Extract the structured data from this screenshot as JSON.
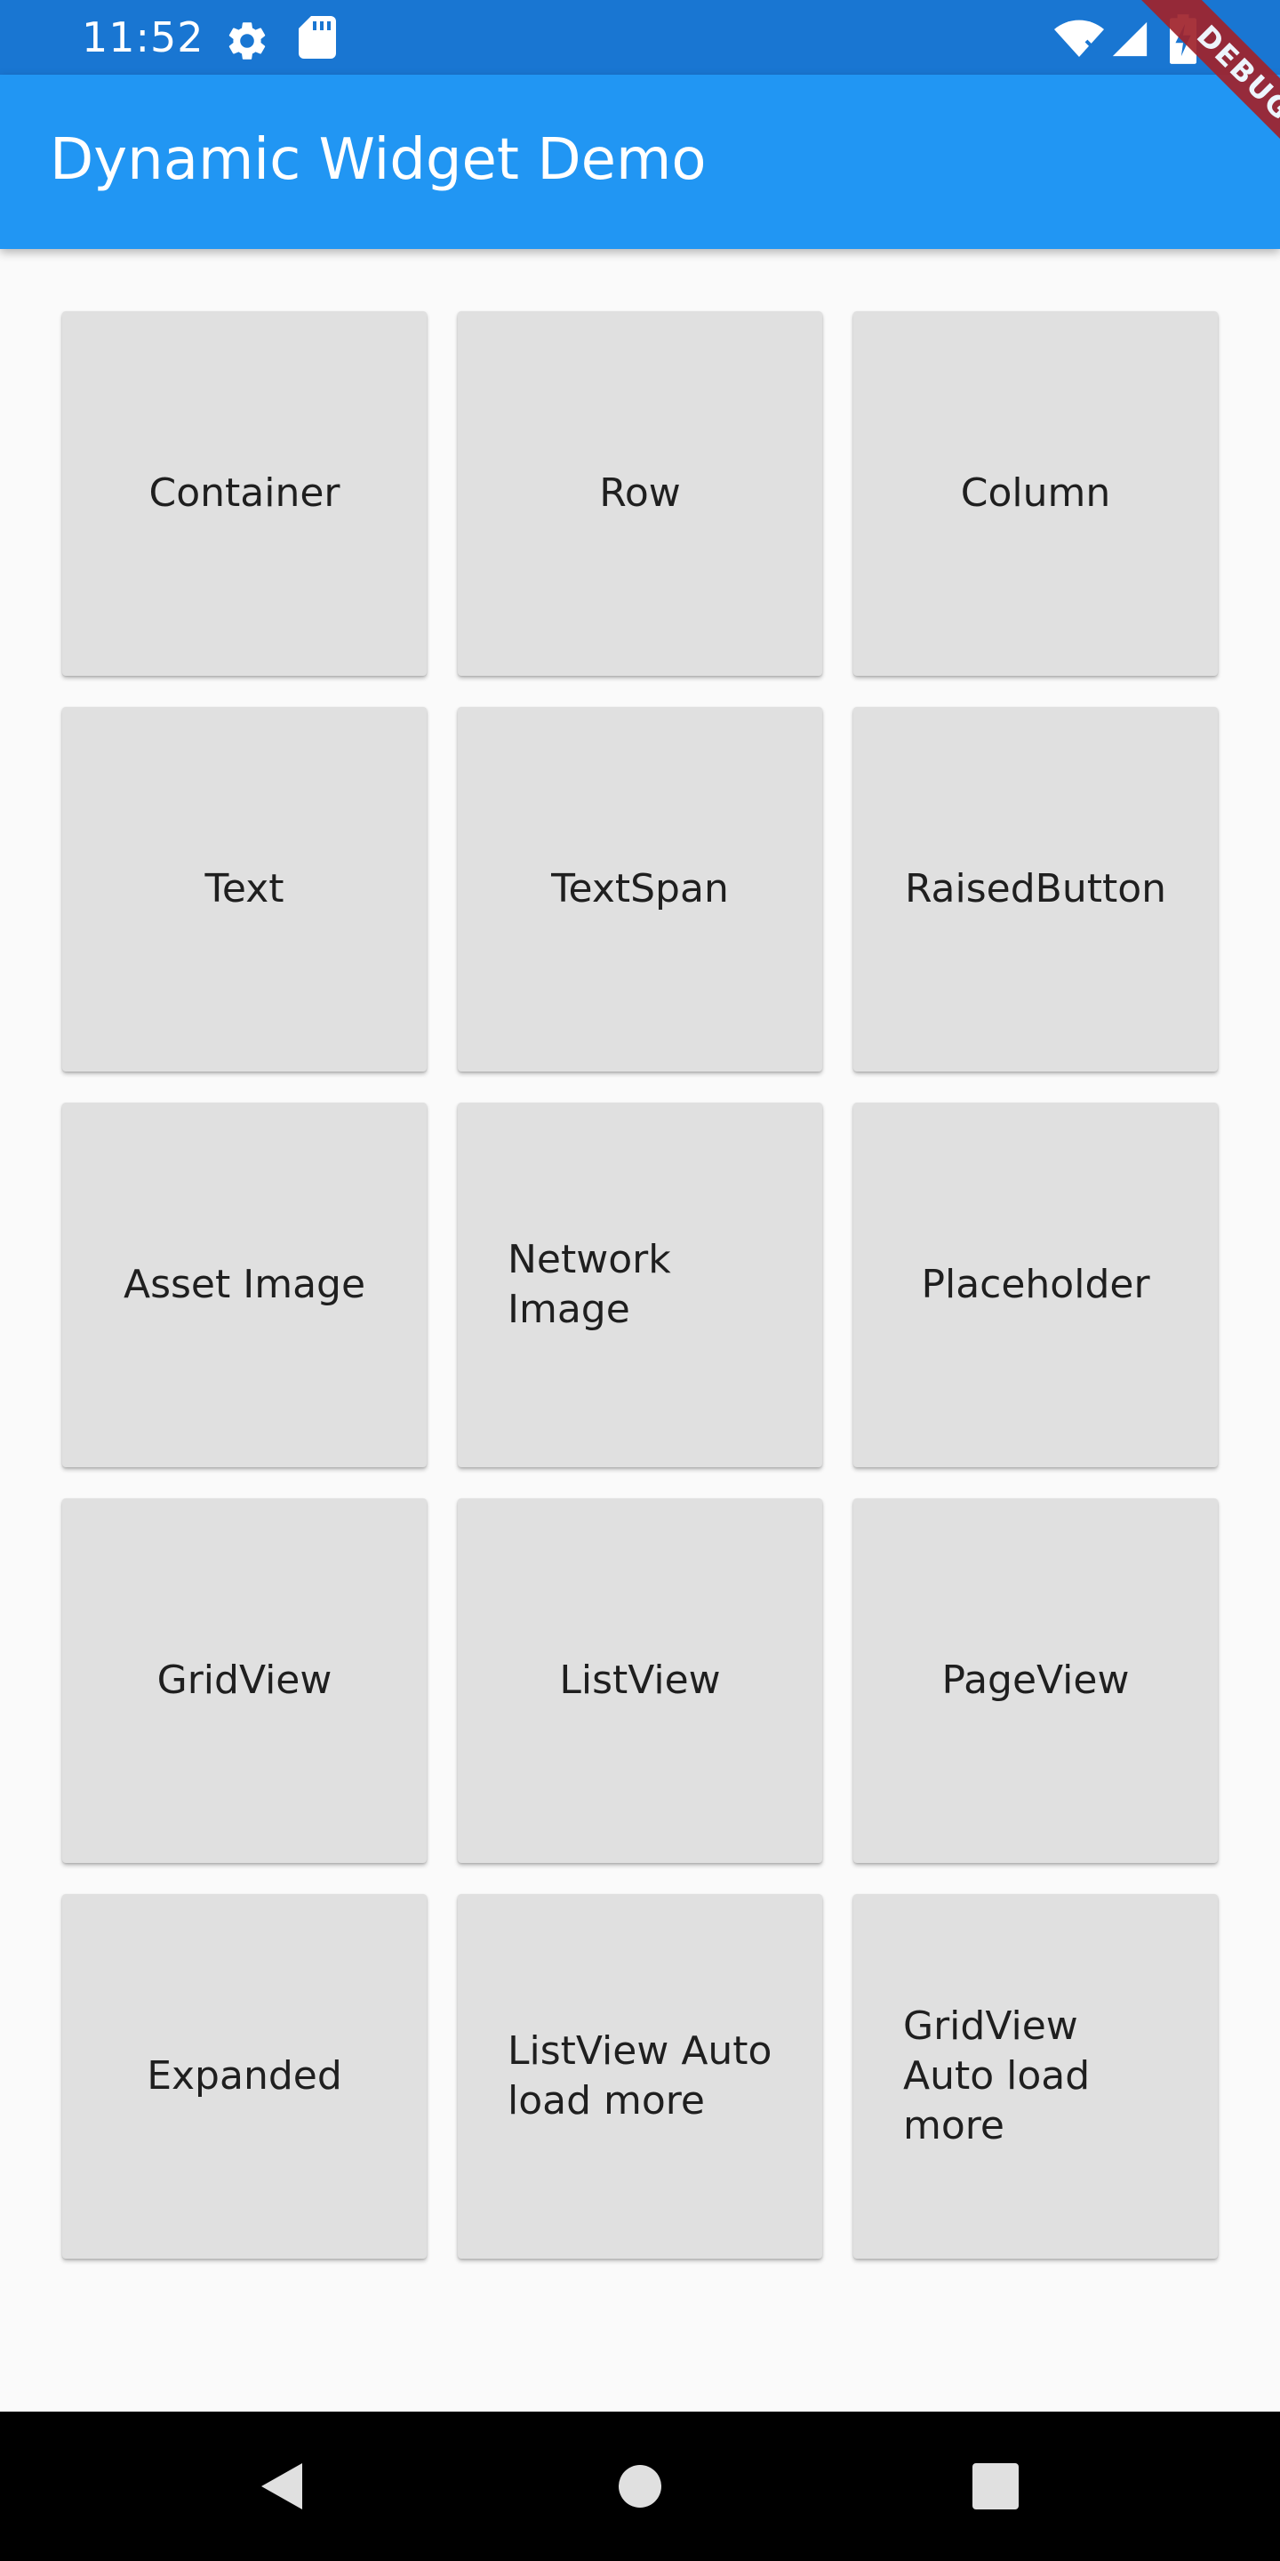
{
  "status_bar": {
    "time": "11:52",
    "background_color": "#1976d2",
    "icons": [
      "gear-icon",
      "sd-card-icon",
      "wifi-icon",
      "cell-signal-icon",
      "battery-charging-icon"
    ]
  },
  "app_bar": {
    "title": "Dynamic Widget Demo",
    "background_color": "#2196f3"
  },
  "debug_banner": {
    "label": "DEBUG",
    "color": "#a0232c"
  },
  "tiles": [
    {
      "label": "Container"
    },
    {
      "label": "Row"
    },
    {
      "label": "Column"
    },
    {
      "label": "Text"
    },
    {
      "label": "TextSpan"
    },
    {
      "label": "RaisedButton"
    },
    {
      "label": "Asset Image"
    },
    {
      "label": "Network Image"
    },
    {
      "label": "Placeholder"
    },
    {
      "label": "GridView"
    },
    {
      "label": "ListView"
    },
    {
      "label": "PageView"
    },
    {
      "label": "Expanded"
    },
    {
      "label": "ListView Auto load more"
    },
    {
      "label": "GridView Auto load more"
    }
  ],
  "tile_color": "#e0e0e0",
  "nav_bar": {
    "buttons": [
      "back-triangle-icon",
      "home-circle-icon",
      "recents-square-icon"
    ]
  }
}
